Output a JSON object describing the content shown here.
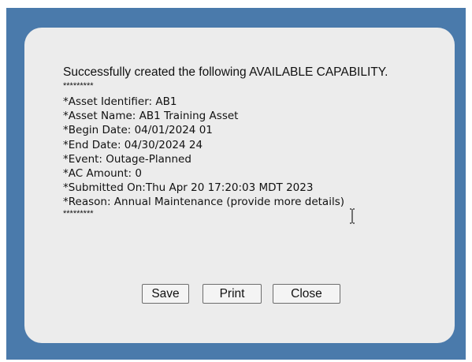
{
  "message": {
    "headline": "Successfully created the following AVAILABLE CAPABILITY.",
    "separator_top": "*********",
    "details": [
      "*Asset Identifier: AB1",
      "*Asset Name: AB1 Training Asset",
      "*Begin Date: 04/01/2024 01",
      "*End Date: 04/30/2024 24",
      "*Event: Outage-Planned",
      "*AC Amount: 0",
      "*Submitted On:Thu Apr 20 17:20:03 MDT 2023",
      "*Reason: Annual Maintenance (provide more details)"
    ],
    "separator_bottom": "*********"
  },
  "buttons": {
    "save": "Save",
    "print": "Print",
    "close": "Close"
  },
  "colors": {
    "frame": "#4a7aab",
    "dialog": "#ececec"
  },
  "icons": {
    "cursor": "text-cursor-icon"
  }
}
